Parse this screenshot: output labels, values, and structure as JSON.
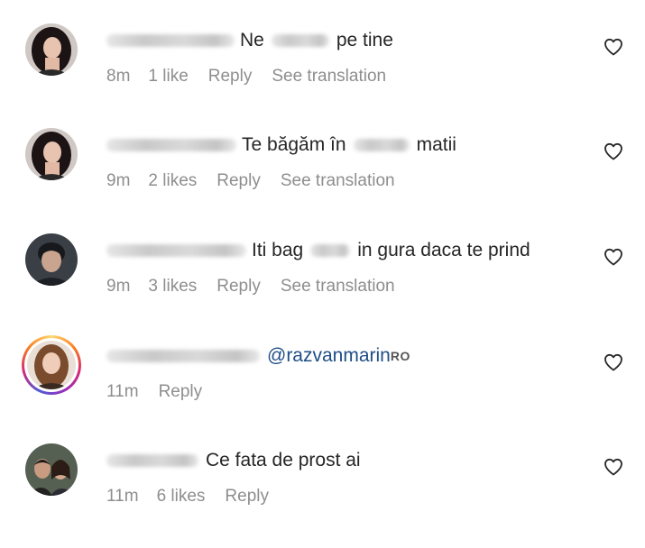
{
  "comments": [
    {
      "text": [
        "Ne",
        "pe tine"
      ],
      "time": "8m",
      "likes": "1 like",
      "reply": "Reply",
      "translation": "See translation",
      "avatar": "avatar-woman-dark-hair"
    },
    {
      "text": [
        "Te băgăm în",
        "matii"
      ],
      "time": "9m",
      "likes": "2 likes",
      "reply": "Reply",
      "translation": "See translation",
      "avatar": "avatar-woman-dark-hair"
    },
    {
      "text": [
        "Iti bag",
        "in gura daca te prind"
      ],
      "time": "9m",
      "likes": "3 likes",
      "reply": "Reply",
      "translation": "See translation",
      "avatar": "avatar-young-man"
    },
    {
      "mention": "@razvanmarin",
      "mention_suffix": "RO",
      "time": "11m",
      "reply": "Reply",
      "avatar": "avatar-woman-story-ring"
    },
    {
      "text": [
        "Ce fata de prost ai"
      ],
      "time": "11m",
      "likes": "6 likes",
      "reply": "Reply",
      "avatar": "avatar-couple"
    }
  ],
  "colors": {
    "text": "#262626",
    "meta": "#8e8e8e",
    "mention": "#1f4e86",
    "heart_stroke": "#262626"
  },
  "icons": {
    "like": "heart-outline-icon"
  }
}
